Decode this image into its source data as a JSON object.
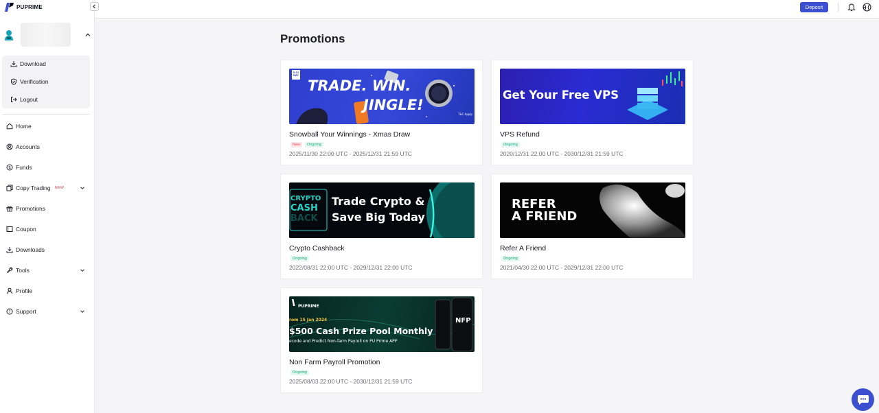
{
  "brand": {
    "name": "PUPRIME",
    "accent": "#3d4fd1"
  },
  "sidebar": {
    "account_menu": [
      {
        "label": "Download",
        "icon": "download-icon"
      },
      {
        "label": "Verification",
        "icon": "shield-check-icon"
      },
      {
        "label": "Logout",
        "icon": "logout-icon"
      }
    ],
    "nav": [
      {
        "label": "Home",
        "icon": "home-icon"
      },
      {
        "label": "Accounts",
        "icon": "user-circle-icon"
      },
      {
        "label": "Funds",
        "icon": "dollar-circle-icon"
      },
      {
        "label": "Copy Trading",
        "icon": "copy-trading-icon",
        "badge": "NEW",
        "expandable": true
      },
      {
        "label": "Promotions",
        "icon": "gift-icon"
      },
      {
        "label": "Coupon",
        "icon": "coupon-icon"
      },
      {
        "label": "Downloads",
        "icon": "download-icon"
      },
      {
        "label": "Tools",
        "icon": "wrench-icon",
        "expandable": true
      },
      {
        "label": "Profile",
        "icon": "user-icon"
      },
      {
        "label": "Support",
        "icon": "question-circle-icon",
        "expandable": true
      }
    ]
  },
  "header": {
    "deposit_label": "Deposit"
  },
  "main": {
    "title": "Promotions",
    "promotions": [
      {
        "title": "Snowball Your Winnings - Xmas Draw",
        "tags": [
          "New",
          "Ongoing"
        ],
        "dates": "2025/11/30 22:00 UTC - 2025/12/31 21:59 UTC",
        "banner": {
          "headline_1": "TRADE. WIN.",
          "headline_2": "JINGLE!",
          "badge_1": "5-31",
          "badge_2": "DEC",
          "note": "T&C Apply"
        }
      },
      {
        "title": "VPS Refund",
        "tags": [
          "Ongoing"
        ],
        "dates": "2020/12/31 22:00 UTC - 2030/12/31 21:59 UTC",
        "banner": {
          "headline": "Get Your Free VPS"
        }
      },
      {
        "title": "Crypto Cashback",
        "tags": [
          "Ongoing"
        ],
        "dates": "2022/08/31 22:00 UTC - 2029/12/31 22:00 UTC",
        "banner": {
          "logo_1": "CRYPTO",
          "logo_2": "CASH",
          "logo_3": "BACK",
          "headline_1": "Trade Crypto &",
          "headline_2": "Save Big Today"
        }
      },
      {
        "title": "Refer A Friend",
        "tags": [
          "Ongoing"
        ],
        "dates": "2021/04/30 22:00 UTC - 2029/12/31 22:00 UTC",
        "banner": {
          "headline_1": "REFER",
          "headline_2": "A FRIEND"
        }
      },
      {
        "title": "Non Farm Payroll Promotion",
        "tags": [
          "Ongoing"
        ],
        "dates": "2025/08/03 22:00 UTC - 2030/12/31 21:59 UTC",
        "banner": {
          "brand": "PUPRIME",
          "kicker": "rom 15 Jan 2024",
          "headline": "$500 Cash Prize Pool Monthly",
          "sub": "ecode and Predict Non-farm Payroll on PU Prime APP",
          "phone_label": "NFP"
        }
      }
    ]
  }
}
